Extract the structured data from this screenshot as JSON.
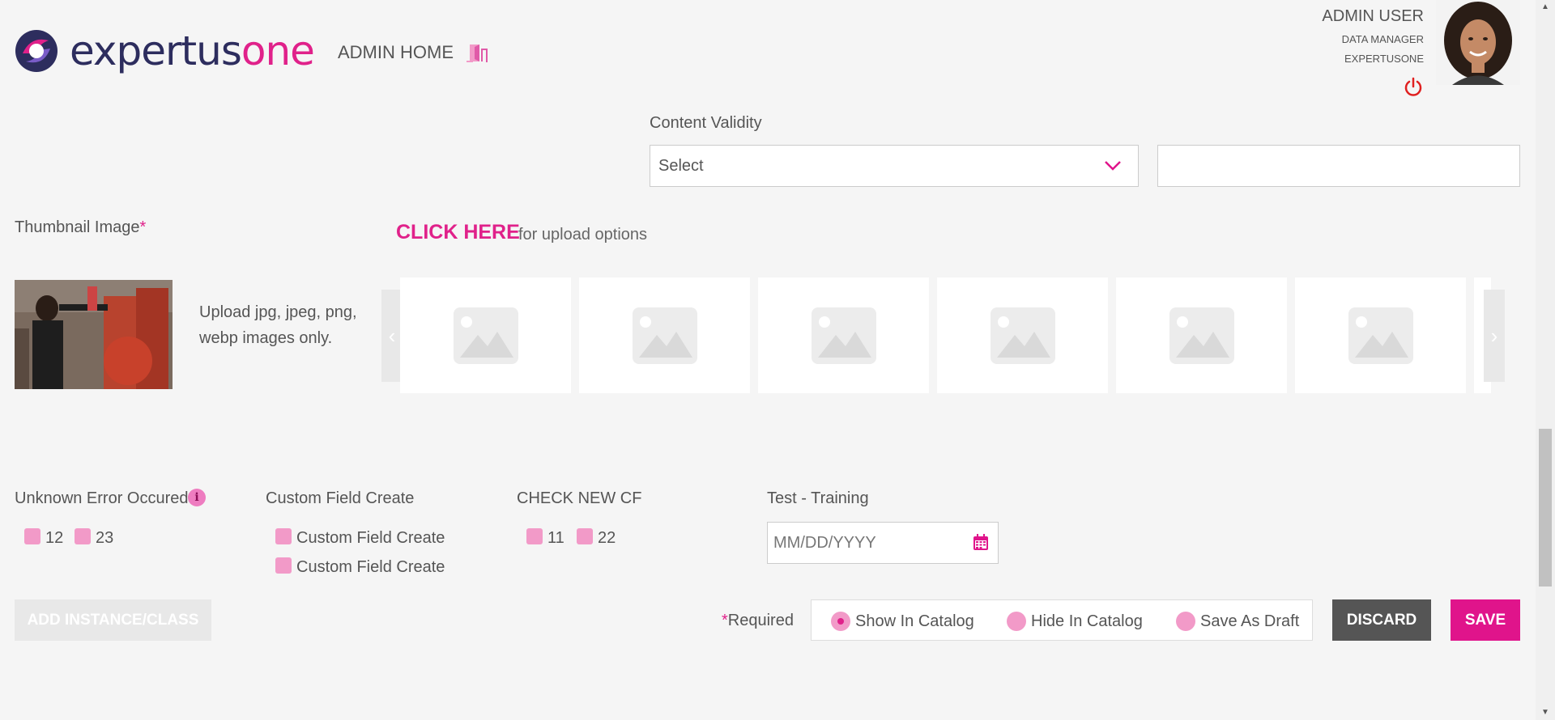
{
  "header": {
    "brand_part1": "expertus",
    "brand_part2": "one",
    "admin_home": "ADMIN HOME",
    "user_name": "ADMIN USER",
    "user_role": "DATA MANAGER",
    "user_org": "EXPERTUSONE",
    "icons": [
      "logo-icon",
      "door-exit-icon",
      "power-icon",
      "avatar"
    ]
  },
  "content_validity": {
    "label": "Content Validity",
    "select_value": "Select",
    "input_value": ""
  },
  "thumbnail": {
    "label": "Thumbnail Image",
    "required_mark": "*",
    "click_here": "CLICK HERE",
    "upload_options": "for upload options",
    "hint": "Upload jpg, jpeg, png, webp images only.",
    "prev_arrow": "‹",
    "next_arrow": "›",
    "tile_count": 6
  },
  "custom_fields": {
    "unknown_error": {
      "label": "Unknown Error Occured",
      "options": [
        "12",
        "23"
      ]
    },
    "custom_field_create": {
      "label": "Custom Field Create",
      "options": [
        "Custom Field Create",
        "Custom Field Create"
      ]
    },
    "check_new_cf": {
      "label": "CHECK NEW CF",
      "options": [
        "11",
        "22"
      ]
    },
    "test_training": {
      "label": "Test - Training",
      "placeholder": "MM/DD/YYYY"
    }
  },
  "actions": {
    "add_instance": "ADD INSTANCE/CLASS",
    "required_mark": "*",
    "required_label": "Required",
    "radio_options": [
      "Show In Catalog",
      "Hide In Catalog",
      "Save As Draft"
    ],
    "radio_selected": "Show In Catalog",
    "discard": "DISCARD",
    "save": "SAVE"
  },
  "colors": {
    "accent": "#e0148b",
    "accent_light": "#f29ac8",
    "brand_dark": "#2d2d5e",
    "discard_bg": "#555555"
  }
}
